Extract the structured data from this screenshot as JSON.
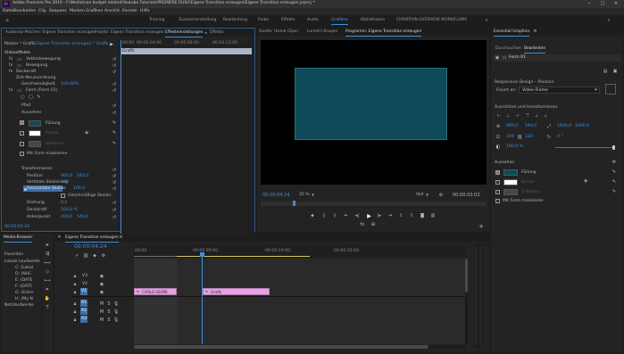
{
  "window": {
    "title": "Adobe Premiere Pro 2019 - F:\\Media\\non budget related\\Youtube Tutorials\\PREMIERE RUSH\\Eigene Transition erzeugen\\Eigene Transition erzeugen.prproj *"
  },
  "menu": [
    "Datei",
    "Bearbeiten",
    "Clip",
    "Sequenz",
    "Marken",
    "Grafiken",
    "Ansicht",
    "Fenster",
    "Hilfe"
  ],
  "workspaces": [
    "Training",
    "Zusammenstellung",
    "Bearbeitung",
    "Farbe",
    "Effekte",
    "Audio",
    "Grafiken",
    "Bibliotheken",
    "CHRISTIAN OVERVIEW WORKFLOWS"
  ],
  "effect_controls": {
    "tabs": [
      "Audioclip-Mischer: Eigene Transition erzeugen",
      "Projekt: Eigene Transition erzeugen",
      "Effekteinstellungen",
      "Effekte"
    ],
    "source": "Master * Grafik",
    "target": "Eigene Transition erzeugen * Grafik",
    "ruler": [
      "00:00",
      "00:00:04:00",
      "00:00:08:00",
      "00:00:12:00"
    ],
    "clip_label": "Grafik",
    "section": "Videoeffekte",
    "rows": [
      {
        "label": "Vektorbewegung",
        "value": ""
      },
      {
        "label": "Bewegung",
        "value": ""
      },
      {
        "label": "Deckkraft",
        "value": ""
      },
      {
        "label": "Zeit-Neuzuordnung",
        "value": ""
      },
      {
        "label": "Geschwindigkeit",
        "value": "100,00%"
      },
      {
        "label": "Form (Form 01)",
        "value": ""
      },
      {
        "label": "Pfad",
        "value": ""
      },
      {
        "label": "Aussehen",
        "value": ""
      }
    ],
    "appearance": {
      "fill": "Füllung",
      "stroke": "Kontur",
      "shadow": "Schatten",
      "mask": "Mit Form maskieren"
    },
    "transform": {
      "title": "Transformieren",
      "position_label": "Position",
      "position_x": "960,0",
      "position_y": "540,0",
      "anchor_label": "Vertikale Skalierung",
      "anchor_value": "100",
      "hscale_label": "Horizontale Skalier.",
      "hscale_value": "100,0",
      "uniform_label": "Gleichmäßige Skalier.",
      "rotation_label": "Drehung",
      "rotation_value": "0,0",
      "opacity_label": "Deckkraft",
      "opacity_value": "100,0 %",
      "anchorpoint_label": "Ankerpunkt",
      "anchorpoint_x": "200,0",
      "anchorpoint_y": "540,0"
    }
  },
  "monitor": {
    "tabs": [
      "Quelle: (keine Clips)",
      "Lumetri-Scopes",
      "Programm: Eigene Transition erzeugen"
    ],
    "timecode": "00:00:04:24",
    "zoom": "25 %",
    "quality": "Voll",
    "duration": "00:00:03:02",
    "canvas_color": "#0f4a5a"
  },
  "essential_graphics": {
    "title": "Essential Graphics",
    "tabs": [
      "Durchsuchen",
      "Bearbeiten"
    ],
    "layer": "Form 01",
    "responsive": "Responsive Design – Position",
    "pin_label": "Fixiert an:",
    "pin_value": "Video-Frame",
    "align_title": "Ausrichten und transformieren",
    "pos_x": "960,0",
    "pos_y": "540,0",
    "size_w": "1600,0",
    "size_h": "1000,0",
    "scale": "100",
    "scale2": "100",
    "rot": "0 °",
    "opacity": "100,0 %",
    "appearance_title": "Aussehen",
    "fill": "Füllung",
    "stroke": "Kontur",
    "shadow": "Schatten",
    "mask": "Mit Form maskieren",
    "fill_color": "#0f4a5a"
  },
  "media_browser": {
    "title": "Media-Browser",
    "items": [
      "Favoriten",
      "Lokale Laufwerke",
      "C: (Lokal",
      "D: (NUC",
      "E: (DATE",
      "F: (DATE",
      "G: (Extrn",
      "H: (My N",
      "Netzlaufwerke"
    ]
  },
  "timeline": {
    "tab": "Eigene Transition erzeugen",
    "timecode": "00:00:04:24",
    "ruler": [
      "00:00",
      "00:00:05:00",
      "00:00:10:00",
      "00:00:15:00"
    ],
    "video_tracks": [
      "V3",
      "V2",
      "V1"
    ],
    "audio_tracks": [
      "A1",
      "A2",
      "A3"
    ],
    "clips": [
      {
        "name": "COOLE AZURE",
        "track": "V1"
      },
      {
        "name": "Grafik",
        "track": "V1"
      }
    ],
    "clip_color": "#e4a3e0"
  }
}
